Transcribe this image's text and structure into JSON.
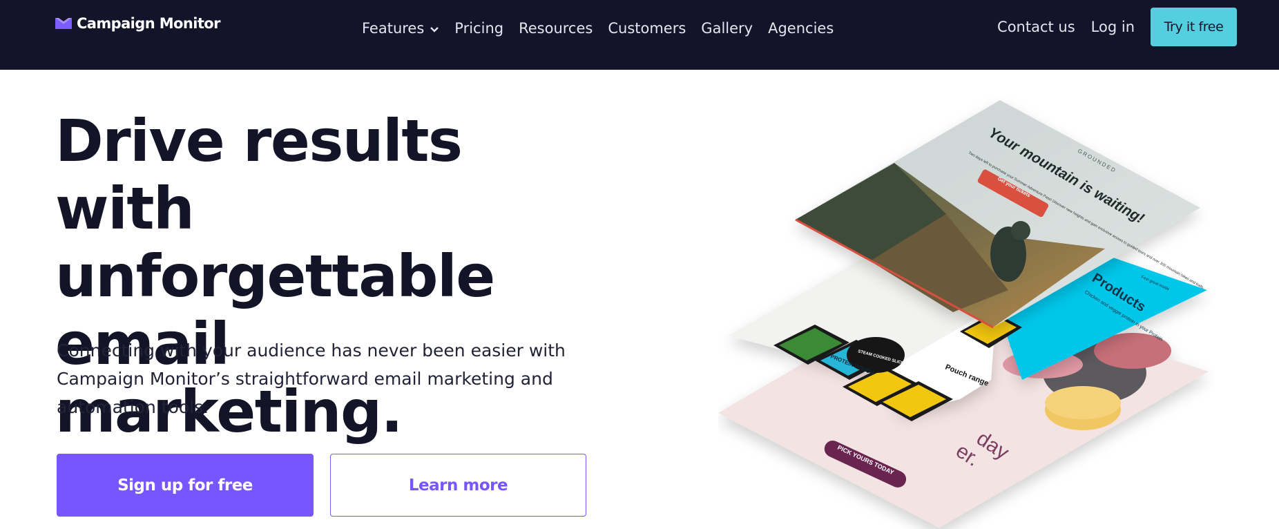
{
  "nav": {
    "brand": "Campaign Monitor",
    "links": [
      {
        "label": "Features",
        "icon": "chevron-down-icon"
      },
      {
        "label": "Pricing"
      },
      {
        "label": "Resources"
      },
      {
        "label": "Customers"
      },
      {
        "label": "Gallery"
      },
      {
        "label": "Agencies"
      }
    ],
    "contact": "Contact us",
    "login": "Log in",
    "cta": "Try it free"
  },
  "hero": {
    "headline_lines": [
      "Drive results with",
      "unforgettable",
      "email marketing."
    ],
    "subtext_lines": [
      "Connecting with your audience has never been easier with",
      "Campaign Monitor’s straightforward email marketing and",
      "automation tools."
    ],
    "primary_cta": "Sign up for free",
    "secondary_cta": "Learn more"
  },
  "illustration": {
    "top_email": {
      "brand": "GROUNDED",
      "heading": "Your mountain is waiting!",
      "body": "Two days left to purchase your Summer Adventure Pass! Discover new heights and gain exclusive access to guided tours and over 300 mountain hikes and trails.",
      "button": "Get your tickets"
    },
    "middle_email": {
      "eyebrow": "Feel great inside",
      "heading": "Products",
      "body": "Chicken and veggie protein in your Protein",
      "pack_1": "PROTEIN POUCH",
      "badge": "STEAM COOKED SLICED CHICKEN",
      "range": "Pouch range"
    },
    "bottom_email": {
      "script_1": "day",
      "script_2": "er.",
      "button": "PICK YOURS TODAY"
    }
  },
  "colors": {
    "nav_bg": "#13142a",
    "accent_purple": "#7856ff",
    "accent_cyan": "#54cfdf",
    "text_dark": "#141428"
  }
}
